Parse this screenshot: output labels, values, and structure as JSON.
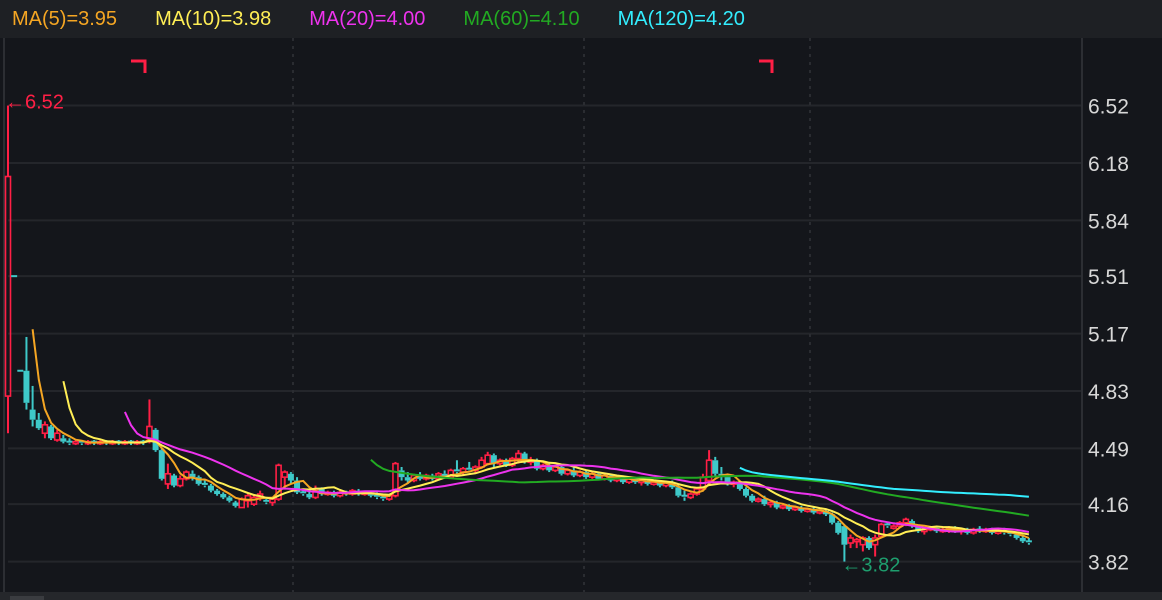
{
  "legend": [
    {
      "label": "MA(5)=3.95",
      "period": 5,
      "color": "#f5a623"
    },
    {
      "label": "MA(10)=3.98",
      "period": 10,
      "color": "#ffee55"
    },
    {
      "label": "MA(20)=4.00",
      "period": 20,
      "color": "#ee33ee"
    },
    {
      "label": "MA(60)=4.10",
      "period": 60,
      "color": "#22aa22"
    },
    {
      "label": "MA(120)=4.20",
      "period": 120,
      "color": "#33eeff"
    }
  ],
  "colors": {
    "up": "#ff1f45",
    "down": "#3ec9c9",
    "high_marker": "#ff1f45",
    "low_marker": "#1e9e6e"
  },
  "chart_data": {
    "type": "candlestick",
    "title": "",
    "y_ticks": [
      "6.52",
      "6.18",
      "5.84",
      "5.51",
      "5.17",
      "4.83",
      "4.49",
      "4.16",
      "3.82"
    ],
    "ylim": [
      3.64,
      6.92
    ],
    "grid": true,
    "annotations": {
      "high": {
        "label": "←6.52",
        "value": 6.52,
        "index": 0
      },
      "low": {
        "label": "←3.82",
        "value": 3.82,
        "index": 136
      }
    },
    "ohlc_fields": [
      "open",
      "high",
      "low",
      "close"
    ],
    "ohlc": [
      [
        4.8,
        6.52,
        4.58,
        6.1
      ],
      [
        5.51,
        5.51,
        5.51,
        5.51
      ],
      [
        4.95,
        4.95,
        4.95,
        4.95
      ],
      [
        4.95,
        5.15,
        4.72,
        4.76
      ],
      [
        4.72,
        4.86,
        4.62,
        4.66
      ],
      [
        4.66,
        4.7,
        4.6,
        4.61
      ],
      [
        4.58,
        4.65,
        4.55,
        4.63
      ],
      [
        4.62,
        4.63,
        4.54,
        4.55
      ],
      [
        4.54,
        4.6,
        4.53,
        4.58
      ],
      [
        4.55,
        4.57,
        4.52,
        4.53
      ],
      [
        4.53,
        4.55,
        4.51,
        4.52
      ],
      [
        4.52,
        4.54,
        4.51,
        4.53
      ],
      [
        4.53,
        4.54,
        4.51,
        4.52
      ],
      [
        4.52,
        4.54,
        4.51,
        4.53
      ],
      [
        4.53,
        4.54,
        4.51,
        4.52
      ],
      [
        4.52,
        4.54,
        4.51,
        4.53
      ],
      [
        4.53,
        4.54,
        4.51,
        4.52
      ],
      [
        4.52,
        4.54,
        4.51,
        4.53
      ],
      [
        4.53,
        4.54,
        4.51,
        4.52
      ],
      [
        4.52,
        4.54,
        4.51,
        4.53
      ],
      [
        4.53,
        4.54,
        4.51,
        4.52
      ],
      [
        4.52,
        4.54,
        4.51,
        4.53
      ],
      [
        4.53,
        4.54,
        4.51,
        4.52
      ],
      [
        4.55,
        4.78,
        4.52,
        4.62
      ],
      [
        4.6,
        4.61,
        4.47,
        4.48
      ],
      [
        4.48,
        4.49,
        4.3,
        4.31
      ],
      [
        4.28,
        4.4,
        4.25,
        4.34
      ],
      [
        4.33,
        4.34,
        4.26,
        4.27
      ],
      [
        4.27,
        4.33,
        4.26,
        4.31
      ],
      [
        4.31,
        4.36,
        4.3,
        4.35
      ],
      [
        4.34,
        4.36,
        4.3,
        4.32
      ],
      [
        4.32,
        4.33,
        4.27,
        4.28
      ],
      [
        4.28,
        4.3,
        4.26,
        4.27
      ],
      [
        4.27,
        4.28,
        4.23,
        4.24
      ],
      [
        4.24,
        4.25,
        4.21,
        4.22
      ],
      [
        4.22,
        4.23,
        4.19,
        4.2
      ],
      [
        4.2,
        4.21,
        4.17,
        4.18
      ],
      [
        4.17,
        4.18,
        4.14,
        4.15
      ],
      [
        4.14,
        4.2,
        4.14,
        4.19
      ],
      [
        4.18,
        4.22,
        4.14,
        4.21
      ],
      [
        4.16,
        4.22,
        4.15,
        4.2
      ],
      [
        4.2,
        4.24,
        4.18,
        4.22
      ],
      [
        4.18,
        4.19,
        4.16,
        4.17
      ],
      [
        4.17,
        4.2,
        4.15,
        4.19
      ],
      [
        4.19,
        4.4,
        4.18,
        4.39
      ],
      [
        4.32,
        4.36,
        4.26,
        4.35
      ],
      [
        4.34,
        4.35,
        4.28,
        4.3
      ],
      [
        4.3,
        4.32,
        4.22,
        4.23
      ],
      [
        4.23,
        4.25,
        4.21,
        4.22
      ],
      [
        4.22,
        4.24,
        4.19,
        4.2
      ],
      [
        4.2,
        4.27,
        4.19,
        4.25
      ],
      [
        4.25,
        4.26,
        4.21,
        4.22
      ],
      [
        4.22,
        4.24,
        4.21,
        4.23
      ],
      [
        4.23,
        4.24,
        4.2,
        4.21
      ],
      [
        4.21,
        4.24,
        4.2,
        4.23
      ],
      [
        4.23,
        4.24,
        4.21,
        4.22
      ],
      [
        4.22,
        4.25,
        4.21,
        4.24
      ],
      [
        4.24,
        4.25,
        4.21,
        4.22
      ],
      [
        4.22,
        4.24,
        4.21,
        4.23
      ],
      [
        4.23,
        4.24,
        4.2,
        4.21
      ],
      [
        4.21,
        4.23,
        4.19,
        4.2
      ],
      [
        4.2,
        4.22,
        4.18,
        4.19
      ],
      [
        4.19,
        4.22,
        4.18,
        4.21
      ],
      [
        4.21,
        4.41,
        4.2,
        4.4
      ],
      [
        4.36,
        4.38,
        4.3,
        4.32
      ],
      [
        4.32,
        4.35,
        4.28,
        4.3
      ],
      [
        4.3,
        4.34,
        4.29,
        4.33
      ],
      [
        4.33,
        4.35,
        4.3,
        4.31
      ],
      [
        4.31,
        4.34,
        4.3,
        4.33
      ],
      [
        4.33,
        4.34,
        4.3,
        4.31
      ],
      [
        4.31,
        4.35,
        4.3,
        4.34
      ],
      [
        4.34,
        4.36,
        4.31,
        4.32
      ],
      [
        4.32,
        4.37,
        4.31,
        4.36
      ],
      [
        4.36,
        4.42,
        4.34,
        4.35
      ],
      [
        4.35,
        4.38,
        4.33,
        4.37
      ],
      [
        4.37,
        4.41,
        4.35,
        4.36
      ],
      [
        4.36,
        4.39,
        4.34,
        4.38
      ],
      [
        4.38,
        4.44,
        4.37,
        4.42
      ],
      [
        4.4,
        4.47,
        4.39,
        4.45
      ],
      [
        4.45,
        4.46,
        4.38,
        4.4
      ],
      [
        4.4,
        4.43,
        4.39,
        4.42
      ],
      [
        4.42,
        4.43,
        4.38,
        4.39
      ],
      [
        4.39,
        4.44,
        4.38,
        4.43
      ],
      [
        4.43,
        4.48,
        4.4,
        4.46
      ],
      [
        4.46,
        4.47,
        4.4,
        4.41
      ],
      [
        4.41,
        4.44,
        4.39,
        4.42
      ],
      [
        4.42,
        4.43,
        4.36,
        4.37
      ],
      [
        4.37,
        4.4,
        4.36,
        4.39
      ],
      [
        4.39,
        4.41,
        4.35,
        4.36
      ],
      [
        4.36,
        4.39,
        4.35,
        4.38
      ],
      [
        4.38,
        4.39,
        4.33,
        4.34
      ],
      [
        4.34,
        4.37,
        4.33,
        4.36
      ],
      [
        4.36,
        4.38,
        4.32,
        4.33
      ],
      [
        4.33,
        4.36,
        4.32,
        4.35
      ],
      [
        4.35,
        4.36,
        4.31,
        4.32
      ],
      [
        4.32,
        4.35,
        4.31,
        4.34
      ],
      [
        4.34,
        4.35,
        4.3,
        4.31
      ],
      [
        4.31,
        4.34,
        4.3,
        4.33
      ],
      [
        4.33,
        4.34,
        4.29,
        4.3
      ],
      [
        4.3,
        4.33,
        4.29,
        4.32
      ],
      [
        4.32,
        4.33,
        4.28,
        4.29
      ],
      [
        4.29,
        4.32,
        4.28,
        4.31
      ],
      [
        4.31,
        4.32,
        4.28,
        4.29
      ],
      [
        4.29,
        4.31,
        4.27,
        4.3
      ],
      [
        4.3,
        4.31,
        4.27,
        4.28
      ],
      [
        4.28,
        4.3,
        4.27,
        4.29
      ],
      [
        4.29,
        4.3,
        4.26,
        4.27
      ],
      [
        4.27,
        4.3,
        4.26,
        4.29
      ],
      [
        4.29,
        4.3,
        4.25,
        4.26
      ],
      [
        4.26,
        4.28,
        4.2,
        4.21
      ],
      [
        4.21,
        4.24,
        4.18,
        4.2
      ],
      [
        4.2,
        4.23,
        4.19,
        4.22
      ],
      [
        4.22,
        4.26,
        4.21,
        4.25
      ],
      [
        4.25,
        4.34,
        4.24,
        4.32
      ],
      [
        4.3,
        4.48,
        4.28,
        4.42
      ],
      [
        4.42,
        4.44,
        4.32,
        4.34
      ],
      [
        4.34,
        4.38,
        4.3,
        4.32
      ],
      [
        4.32,
        4.33,
        4.27,
        4.28
      ],
      [
        4.28,
        4.3,
        4.26,
        4.29
      ],
      [
        4.29,
        4.3,
        4.24,
        4.25
      ],
      [
        4.25,
        4.26,
        4.2,
        4.21
      ],
      [
        4.21,
        4.22,
        4.17,
        4.18
      ],
      [
        4.18,
        4.2,
        4.17,
        4.19
      ],
      [
        4.19,
        4.21,
        4.15,
        4.16
      ],
      [
        4.16,
        4.18,
        4.14,
        4.17
      ],
      [
        4.17,
        4.18,
        4.13,
        4.14
      ],
      [
        4.14,
        4.16,
        4.13,
        4.15
      ],
      [
        4.15,
        4.16,
        4.12,
        4.13
      ],
      [
        4.13,
        4.15,
        4.12,
        4.14
      ],
      [
        4.14,
        4.15,
        4.11,
        4.12
      ],
      [
        4.12,
        4.14,
        4.11,
        4.13
      ],
      [
        4.13,
        4.14,
        4.1,
        4.11
      ],
      [
        4.11,
        4.13,
        4.1,
        4.12
      ],
      [
        4.12,
        4.13,
        4.09,
        4.1
      ],
      [
        4.1,
        4.11,
        4.04,
        4.05
      ],
      [
        4.05,
        4.06,
        3.98,
        3.99
      ],
      [
        4.03,
        4.04,
        3.82,
        3.92
      ],
      [
        3.93,
        3.98,
        3.9,
        3.96
      ],
      [
        3.94,
        3.96,
        3.9,
        3.95
      ],
      [
        3.92,
        3.97,
        3.88,
        3.96
      ],
      [
        3.96,
        3.97,
        3.89,
        3.9
      ],
      [
        3.92,
        3.98,
        3.85,
        3.96
      ],
      [
        3.97,
        4.05,
        3.96,
        4.04
      ],
      [
        4.04,
        4.05,
        4.02,
        4.03
      ],
      [
        4.02,
        4.04,
        4.01,
        4.03
      ],
      [
        4.03,
        4.06,
        4.02,
        4.05
      ],
      [
        4.05,
        4.08,
        4.03,
        4.07
      ],
      [
        4.06,
        4.07,
        4.02,
        4.03
      ],
      [
        4.03,
        4.04,
        3.99,
        4.0
      ],
      [
        4.0,
        4.02,
        3.98,
        4.01
      ],
      [
        4.01,
        4.03,
        4.0,
        4.02
      ],
      [
        4.02,
        4.03,
        3.99,
        4.0
      ],
      [
        4.0,
        4.02,
        3.99,
        4.01
      ],
      [
        4.01,
        4.03,
        3.99,
        4.02
      ],
      [
        4.02,
        4.03,
        3.99,
        4.0
      ],
      [
        4.0,
        4.02,
        3.98,
        4.01
      ],
      [
        4.01,
        4.02,
        3.98,
        3.99
      ],
      [
        3.99,
        4.02,
        3.98,
        4.01
      ],
      [
        4.01,
        4.03,
        3.99,
        4.0
      ],
      [
        4.0,
        4.02,
        3.99,
        4.01
      ],
      [
        4.01,
        4.02,
        3.98,
        3.99
      ],
      [
        3.99,
        4.01,
        3.98,
        4.0
      ],
      [
        4.0,
        4.02,
        3.98,
        3.99
      ],
      [
        3.99,
        4.0,
        3.97,
        3.98
      ],
      [
        3.98,
        3.99,
        3.95,
        3.96
      ],
      [
        3.96,
        3.97,
        3.93,
        3.94
      ],
      [
        3.94,
        3.96,
        3.92,
        3.93
      ]
    ]
  }
}
